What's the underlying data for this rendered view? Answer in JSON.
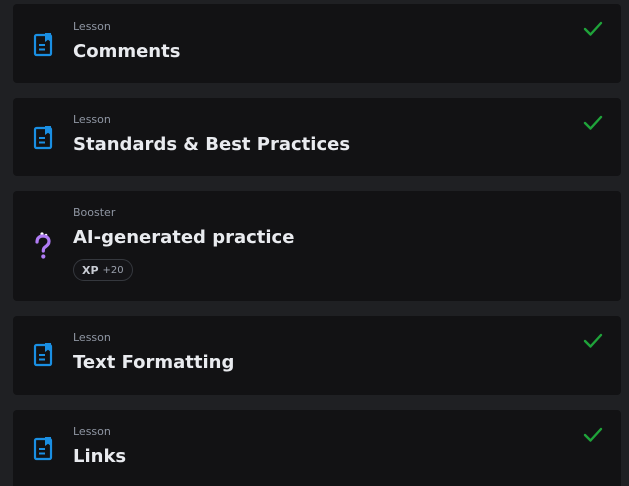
{
  "items": [
    {
      "type": "Lesson",
      "title": "Comments",
      "icon": "lesson-doc-icon",
      "completed": true
    },
    {
      "type": "Lesson",
      "title": "Standards & Best Practices",
      "icon": "lesson-doc-icon",
      "completed": true
    },
    {
      "type": "Booster",
      "title": "AI-generated practice",
      "icon": "question-bot-icon",
      "completed": false,
      "xp_label": "XP",
      "xp_value": "+20"
    },
    {
      "type": "Lesson",
      "title": "Text Formatting",
      "icon": "lesson-doc-icon",
      "completed": true
    },
    {
      "type": "Lesson",
      "title": "Links",
      "icon": "lesson-doc-icon",
      "completed": true
    }
  ],
  "colors": {
    "background": "#1f2023",
    "card": "#121214",
    "lesson_icon": "#1a8fe3",
    "booster_icon": "#b07cf5",
    "check": "#1fa33a"
  }
}
